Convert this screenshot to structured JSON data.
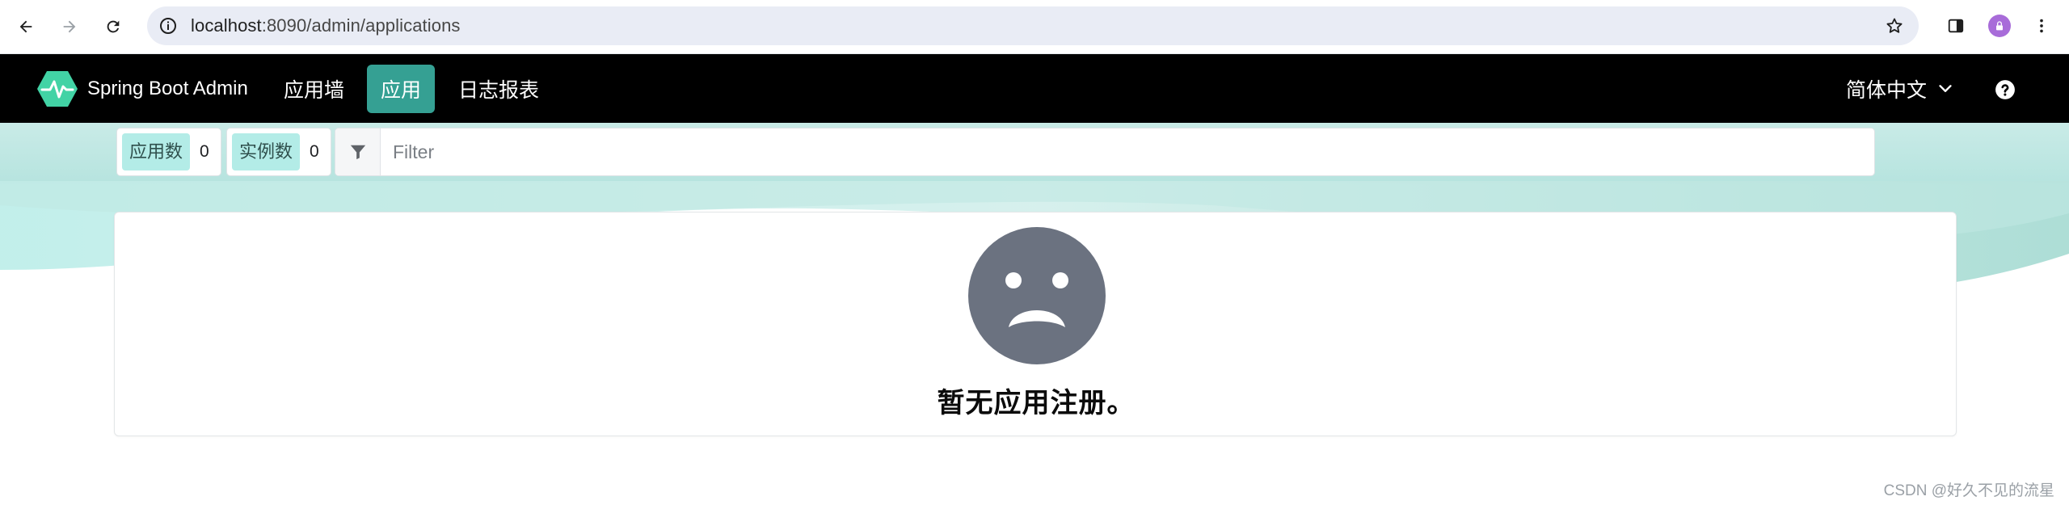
{
  "browser": {
    "url_host": "localhost",
    "url_rest": ":8090/admin/applications"
  },
  "navbar": {
    "brand": "Spring Boot Admin",
    "items": [
      {
        "label": "应用墙",
        "active": false
      },
      {
        "label": "应用",
        "active": true
      },
      {
        "label": "日志报表",
        "active": false
      }
    ],
    "language": "简体中文"
  },
  "toolbar": {
    "app_count_label": "应用数",
    "app_count": "0",
    "instance_count_label": "实例数",
    "instance_count": "0",
    "filter_placeholder": "Filter"
  },
  "empty_state": {
    "message": "暂无应用注册。",
    "icon": "sad-face-icon"
  },
  "watermark": "CSDN @好久不见的流星",
  "colors": {
    "navbar_bg": "#000000",
    "accent": "#35a093",
    "tag_bg": "#b3ece7",
    "band_bg": "#c9ebe7",
    "icon_gray": "#6b7280"
  }
}
